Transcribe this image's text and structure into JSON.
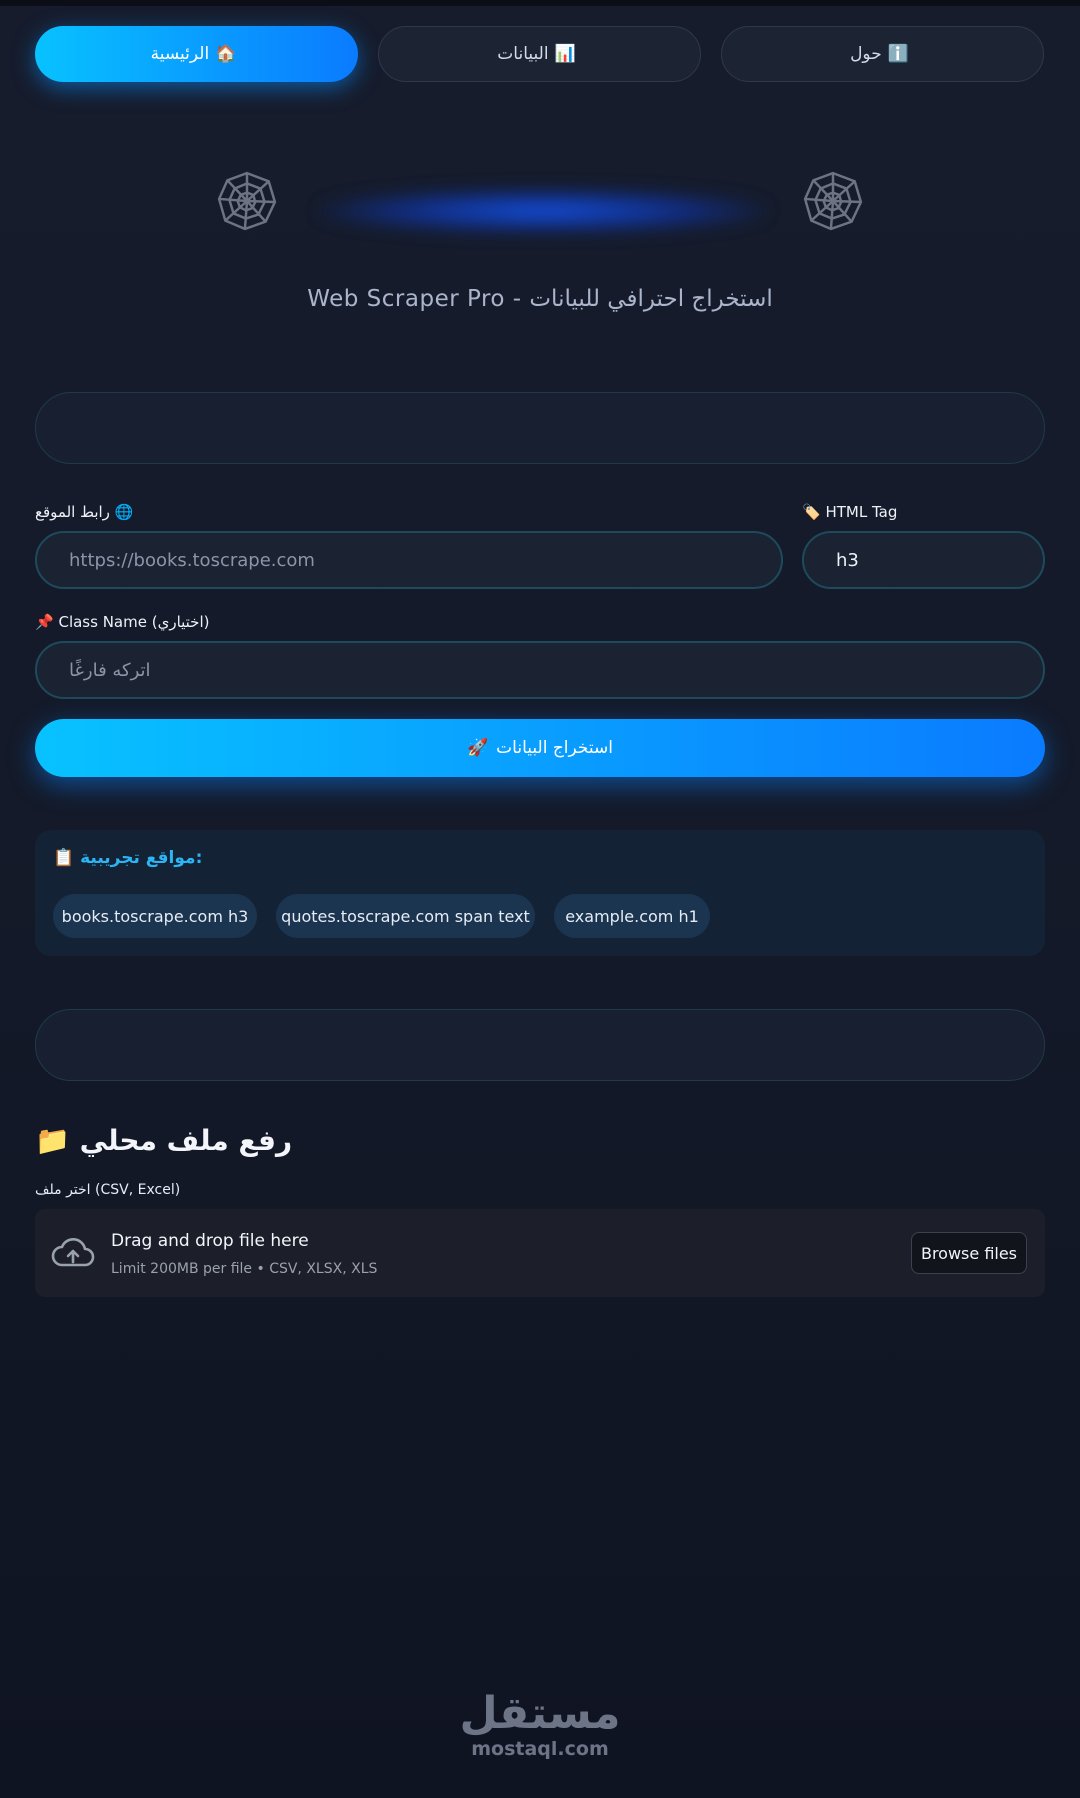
{
  "nav": {
    "tabs": [
      {
        "label": "الرئيسية",
        "icon": "🏠",
        "icon_name": "house-icon",
        "active": true
      },
      {
        "label": "البيانات",
        "icon": "📊",
        "icon_name": "bar-chart-icon",
        "active": false
      },
      {
        "label": "حول",
        "icon": "ℹ️",
        "icon_name": "info-icon",
        "active": false
      }
    ]
  },
  "hero": {
    "icon_name": "spider-web-icon",
    "subtitle": "Web Scraper Pro - استخراج احترافي للبيانات"
  },
  "form": {
    "url_label": "رابط الموقع",
    "url_icon": "🌐",
    "url_placeholder": "https://books.toscrape.com",
    "tag_label": "HTML Tag",
    "tag_icon": "🏷️",
    "tag_value": "h3",
    "class_label": "Class Name (اختياري)",
    "class_icon": "📌",
    "class_placeholder": "اتركه فارغًا",
    "submit_label": "استخراج البيانات",
    "submit_icon": "🚀"
  },
  "samples": {
    "title": "مواقع تجريبية:",
    "title_icon": "📋",
    "items": [
      "books.toscrape.com h3",
      "quotes.toscrape.com span text",
      "example.com h1"
    ]
  },
  "upload": {
    "title": "رفع ملف محلي",
    "title_icon": "📁",
    "label": "اختر ملف (CSV, Excel)",
    "drop_text": "Drag and drop file here",
    "limit_text": "Limit 200MB per file • CSV, XLSX, XLS",
    "browse_label": "Browse files"
  },
  "watermark": {
    "arabic": "مستقل",
    "latin": "mostaql.com"
  },
  "colors": {
    "background": "#141a29",
    "accent_start": "#08c2ff",
    "accent_end": "#0a7bff",
    "samples_title": "#2cb5f5"
  }
}
